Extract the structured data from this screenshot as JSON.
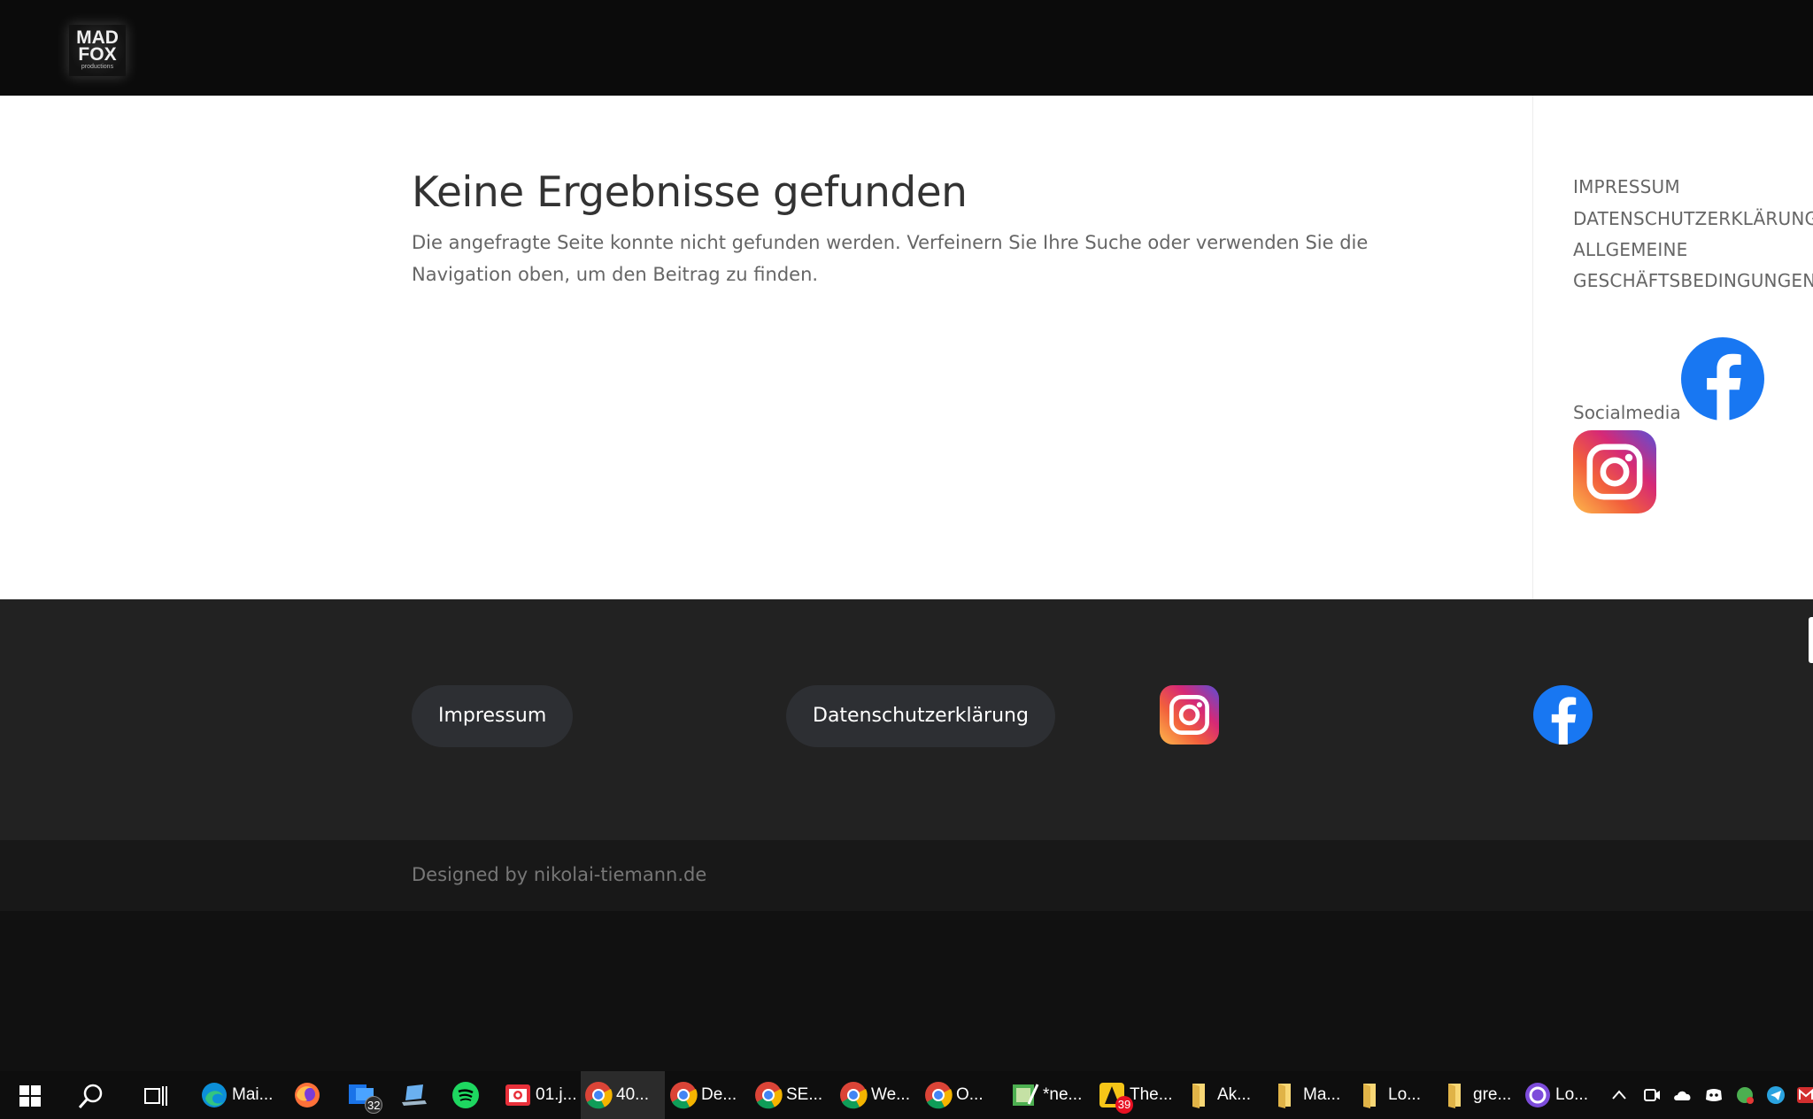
{
  "header": {
    "logo_line1": "MAD",
    "logo_line2": "FOX",
    "logo_line3": "productions"
  },
  "main": {
    "title": "Keine Ergebnisse gefunden",
    "message": "Die angefragte Seite konnte nicht gefunden werden. Verfeinern Sie Ihre Suche oder verwenden Sie die Navigation oben, um den Beitrag zu finden."
  },
  "sidebar": {
    "links": [
      "IMPRESSUM",
      "DATENSCHUTZERKLÄRUNG",
      "ALLGEMEINE",
      "GESCHÄFTSBEDINGUNGEN"
    ],
    "social_label": "Socialmedia",
    "icons": [
      "facebook-icon",
      "instagram-icon"
    ]
  },
  "footer": {
    "button_impressum": "Impressum",
    "button_datenschutz": "Datenschutzerklärung",
    "icons": [
      "instagram-icon",
      "facebook-icon"
    ],
    "credit": "Designed by nikolai-tiemann.de"
  },
  "taskbar": {
    "items": [
      {
        "icon": "edge-icon",
        "label": "Mai..."
      },
      {
        "icon": "firefox-icon",
        "label": ""
      },
      {
        "icon": "mail-icon",
        "label": "",
        "badge": "32"
      },
      {
        "icon": "laptop-icon",
        "label": ""
      },
      {
        "icon": "spotify-icon",
        "label": ""
      },
      {
        "icon": "camera-icon",
        "label": "01.j..."
      },
      {
        "icon": "chrome-icon",
        "label": "40...",
        "active": true
      },
      {
        "icon": "chrome-icon",
        "label": "De..."
      },
      {
        "icon": "chrome-icon",
        "label": "SE..."
      },
      {
        "icon": "chrome-icon",
        "label": "We..."
      },
      {
        "icon": "chrome-icon",
        "label": "O..."
      },
      {
        "icon": "paint-icon",
        "label": "*ne..."
      },
      {
        "icon": "game-icon",
        "label": "The...",
        "badge": "39"
      },
      {
        "icon": "folder-icon",
        "label": "Ak..."
      },
      {
        "icon": "folder-icon",
        "label": "Ma..."
      },
      {
        "icon": "folder-icon",
        "label": "Lo..."
      },
      {
        "icon": "folder-icon",
        "label": "gre..."
      },
      {
        "icon": "app-circle-icon",
        "label": "Lo..."
      }
    ],
    "tray_icons": [
      "chevron-up-icon",
      "meet-icon",
      "cloud-icon",
      "discord-icon",
      "shield-check-icon",
      "telegram-icon",
      "mail-m-icon"
    ]
  }
}
